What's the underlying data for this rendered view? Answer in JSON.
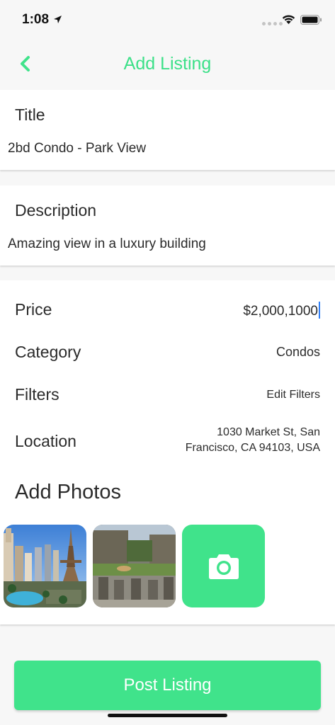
{
  "status_bar": {
    "time": "1:08",
    "icons": [
      "location-arrow-icon",
      "signal-icon",
      "wifi-icon",
      "battery-icon"
    ]
  },
  "nav": {
    "title": "Add Listing",
    "back_icon": "chevron-left-icon"
  },
  "form": {
    "title_label": "Title",
    "title_value": "2bd Condo - Park View",
    "description_label": "Description",
    "description_value": "Amazing view in a luxury building",
    "price_label": "Price",
    "price_value": "$2,000,1000",
    "category_label": "Category",
    "category_value": "Condos",
    "filters_label": "Filters",
    "filters_value": "Edit Filters",
    "location_label": "Location",
    "location_line1": "1030 Market St, San",
    "location_line2": "Francisco, CA 94103, USA"
  },
  "photos": {
    "heading": "Add Photos",
    "add_icon": "camera-icon"
  },
  "actions": {
    "post_label": "Post Listing"
  },
  "colors": {
    "accent": "#40e38b",
    "nav_title": "#3ce088",
    "background": "#f7f7f7",
    "cursor": "#2f7ef6"
  }
}
